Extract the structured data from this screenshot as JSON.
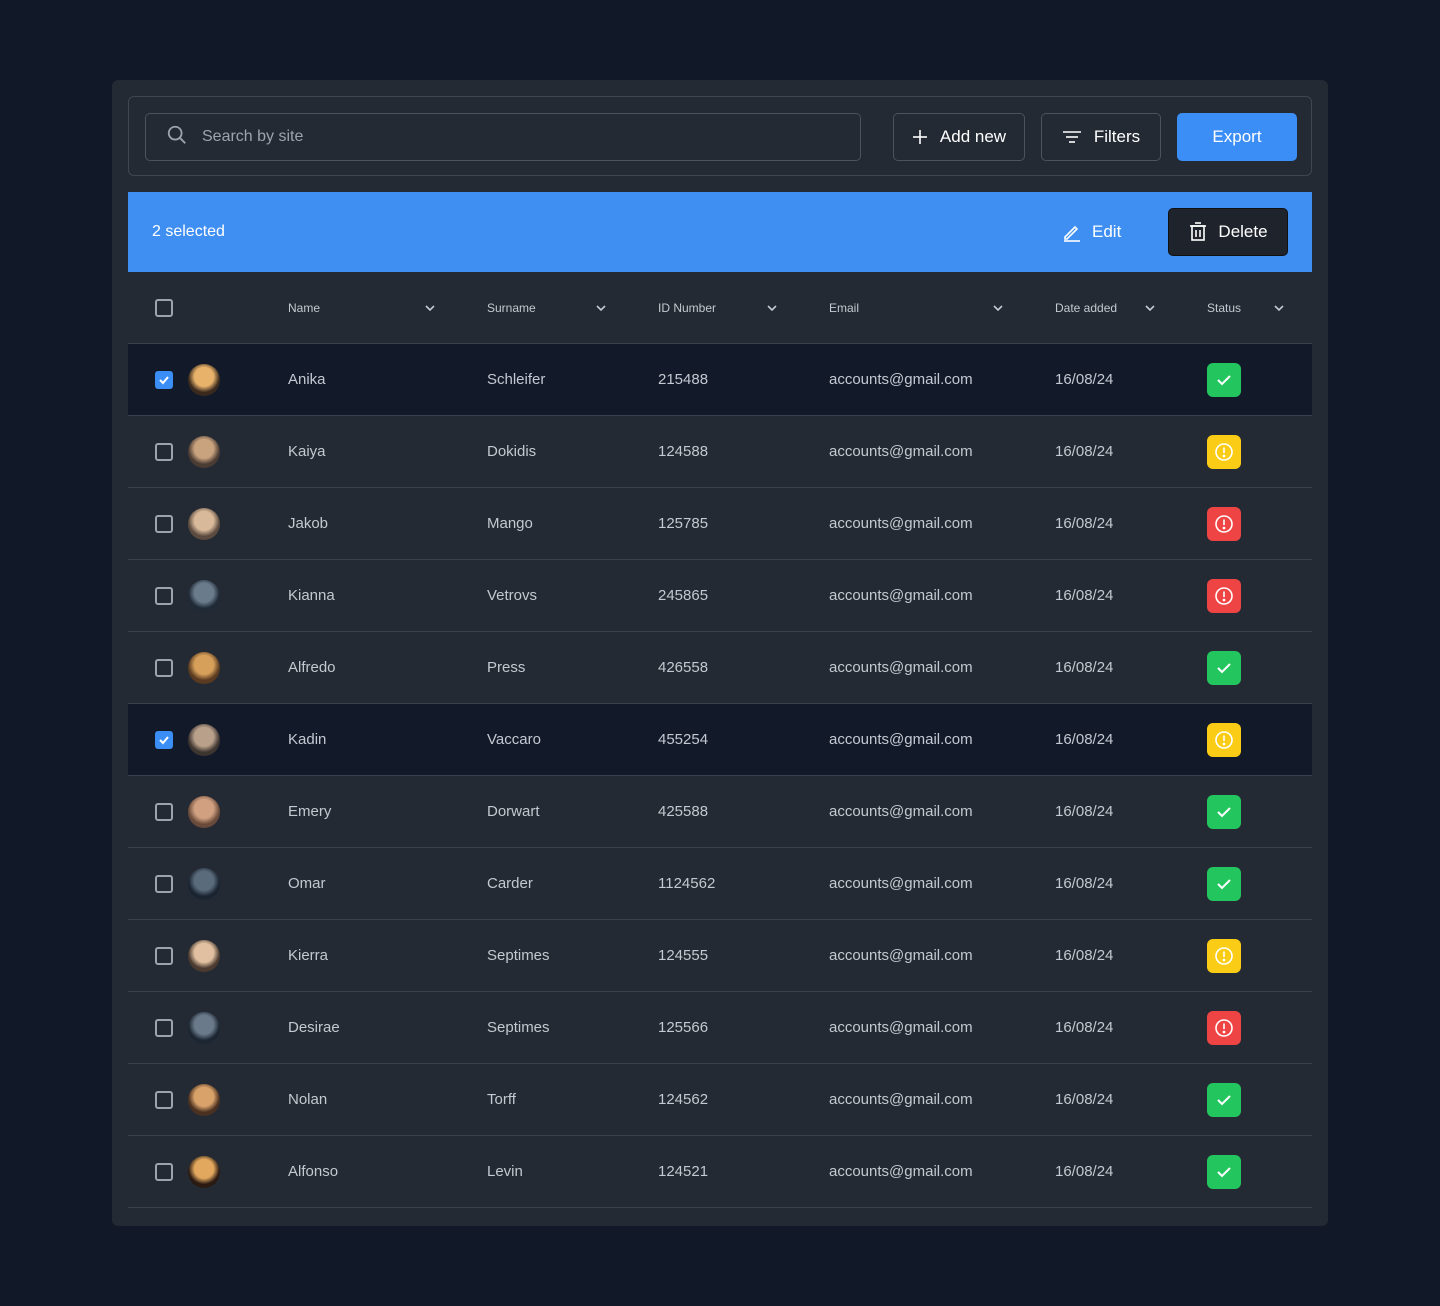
{
  "toolbar": {
    "search_placeholder": "Search by site",
    "add_new_label": "Add new",
    "filters_label": "Filters",
    "export_label": "Export"
  },
  "selection_bar": {
    "count_label": "2 selected",
    "edit_label": "Edit",
    "delete_label": "Delete"
  },
  "columns": {
    "name": "Name",
    "surname": "Surname",
    "id_number": "ID Number",
    "email": "Email",
    "date_added": "Date added",
    "status": "Status"
  },
  "colors": {
    "accent": "#3b8ef5",
    "status_ok": "#22c55e",
    "status_warn": "#facc15",
    "status_error": "#ef4444"
  },
  "rows": [
    {
      "name": "Anika",
      "surname": "Schleifer",
      "id": "215488",
      "email": "accounts@gmail.com",
      "date": "16/08/24",
      "status": "ok",
      "checked": true
    },
    {
      "name": "Kaiya",
      "surname": "Dokidis",
      "id": "124588",
      "email": "accounts@gmail.com",
      "date": "16/08/24",
      "status": "warn",
      "checked": false
    },
    {
      "name": "Jakob",
      "surname": "Mango",
      "id": "125785",
      "email": "accounts@gmail.com",
      "date": "16/08/24",
      "status": "err",
      "checked": false
    },
    {
      "name": "Kianna",
      "surname": "Vetrovs",
      "id": "245865",
      "email": "accounts@gmail.com",
      "date": "16/08/24",
      "status": "err",
      "checked": false
    },
    {
      "name": "Alfredo",
      "surname": "Press",
      "id": "426558",
      "email": "accounts@gmail.com",
      "date": "16/08/24",
      "status": "ok",
      "checked": false
    },
    {
      "name": "Kadin",
      "surname": "Vaccaro",
      "id": "455254",
      "email": "accounts@gmail.com",
      "date": "16/08/24",
      "status": "warn",
      "checked": true
    },
    {
      "name": "Emery",
      "surname": "Dorwart",
      "id": "425588",
      "email": "accounts@gmail.com",
      "date": "16/08/24",
      "status": "ok",
      "checked": false
    },
    {
      "name": "Omar",
      "surname": "Carder",
      "id": "1124562",
      "email": "accounts@gmail.com",
      "date": "16/08/24",
      "status": "ok",
      "checked": false
    },
    {
      "name": "Kierra",
      "surname": "Septimes",
      "id": "124555",
      "email": "accounts@gmail.com",
      "date": "16/08/24",
      "status": "warn",
      "checked": false
    },
    {
      "name": "Desirae",
      "surname": "Septimes",
      "id": "125566",
      "email": "accounts@gmail.com",
      "date": "16/08/24",
      "status": "err",
      "checked": false
    },
    {
      "name": "Nolan",
      "surname": "Torff",
      "id": "124562",
      "email": "accounts@gmail.com",
      "date": "16/08/24",
      "status": "ok",
      "checked": false
    },
    {
      "name": "Alfonso",
      "surname": "Levin",
      "id": "124521",
      "email": "accounts@gmail.com",
      "date": "16/08/24",
      "status": "ok",
      "checked": false
    }
  ]
}
